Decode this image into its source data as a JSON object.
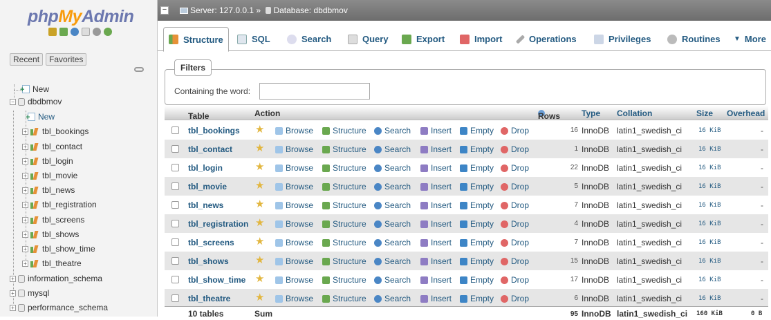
{
  "logo": {
    "part1": "php",
    "part2": "My",
    "part3": "Admin"
  },
  "nav": {
    "recent_label": "Recent",
    "favorites_label": "Favorites",
    "new_label": "New",
    "database": "dbdbmov",
    "db_new_label": "New",
    "tables": [
      "tbl_bookings",
      "tbl_contact",
      "tbl_login",
      "tbl_movie",
      "tbl_news",
      "tbl_registration",
      "tbl_screens",
      "tbl_shows",
      "tbl_show_time",
      "tbl_theatre"
    ],
    "other_dbs": [
      "information_schema",
      "mysql",
      "performance_schema"
    ]
  },
  "breadcrumb": {
    "server": "Server: 127.0.0.1",
    "sep": "»",
    "database": "Database: dbdbmov"
  },
  "tabs": [
    "Structure",
    "SQL",
    "Search",
    "Query",
    "Export",
    "Import",
    "Operations",
    "Privileges",
    "Routines",
    "More"
  ],
  "filters": {
    "legend": "Filters",
    "label": "Containing the word:",
    "value": ""
  },
  "table": {
    "headers": {
      "table": "Table",
      "action": "Action",
      "rows": "Rows",
      "type": "Type",
      "collation": "Collation",
      "size": "Size",
      "overhead": "Overhead"
    },
    "actions": [
      "Browse",
      "Structure",
      "Search",
      "Insert",
      "Empty",
      "Drop"
    ],
    "rows": [
      {
        "name": "tbl_bookings",
        "rows": "16",
        "type": "InnoDB",
        "collation": "latin1_swedish_ci",
        "size": "16 KiB",
        "overhead": "-"
      },
      {
        "name": "tbl_contact",
        "rows": "1",
        "type": "InnoDB",
        "collation": "latin1_swedish_ci",
        "size": "16 KiB",
        "overhead": "-"
      },
      {
        "name": "tbl_login",
        "rows": "22",
        "type": "InnoDB",
        "collation": "latin1_swedish_ci",
        "size": "16 KiB",
        "overhead": "-"
      },
      {
        "name": "tbl_movie",
        "rows": "5",
        "type": "InnoDB",
        "collation": "latin1_swedish_ci",
        "size": "16 KiB",
        "overhead": "-"
      },
      {
        "name": "tbl_news",
        "rows": "7",
        "type": "InnoDB",
        "collation": "latin1_swedish_ci",
        "size": "16 KiB",
        "overhead": "-"
      },
      {
        "name": "tbl_registration",
        "rows": "4",
        "type": "InnoDB",
        "collation": "latin1_swedish_ci",
        "size": "16 KiB",
        "overhead": "-"
      },
      {
        "name": "tbl_screens",
        "rows": "7",
        "type": "InnoDB",
        "collation": "latin1_swedish_ci",
        "size": "16 KiB",
        "overhead": "-"
      },
      {
        "name": "tbl_shows",
        "rows": "15",
        "type": "InnoDB",
        "collation": "latin1_swedish_ci",
        "size": "16 KiB",
        "overhead": "-"
      },
      {
        "name": "tbl_show_time",
        "rows": "17",
        "type": "InnoDB",
        "collation": "latin1_swedish_ci",
        "size": "16 KiB",
        "overhead": "-"
      },
      {
        "name": "tbl_theatre",
        "rows": "6",
        "type": "InnoDB",
        "collation": "latin1_swedish_ci",
        "size": "16 KiB",
        "overhead": "-"
      }
    ],
    "footer": {
      "count": "10 tables",
      "sum": "Sum",
      "rows": "95",
      "type": "InnoDB",
      "collation": "latin1_swedish_ci",
      "size": "160 KiB",
      "overhead": "0 B"
    }
  },
  "colors": {
    "link": "#235a81",
    "topbar": "#7a7a7a",
    "row_alt": "#e6e6e6"
  }
}
